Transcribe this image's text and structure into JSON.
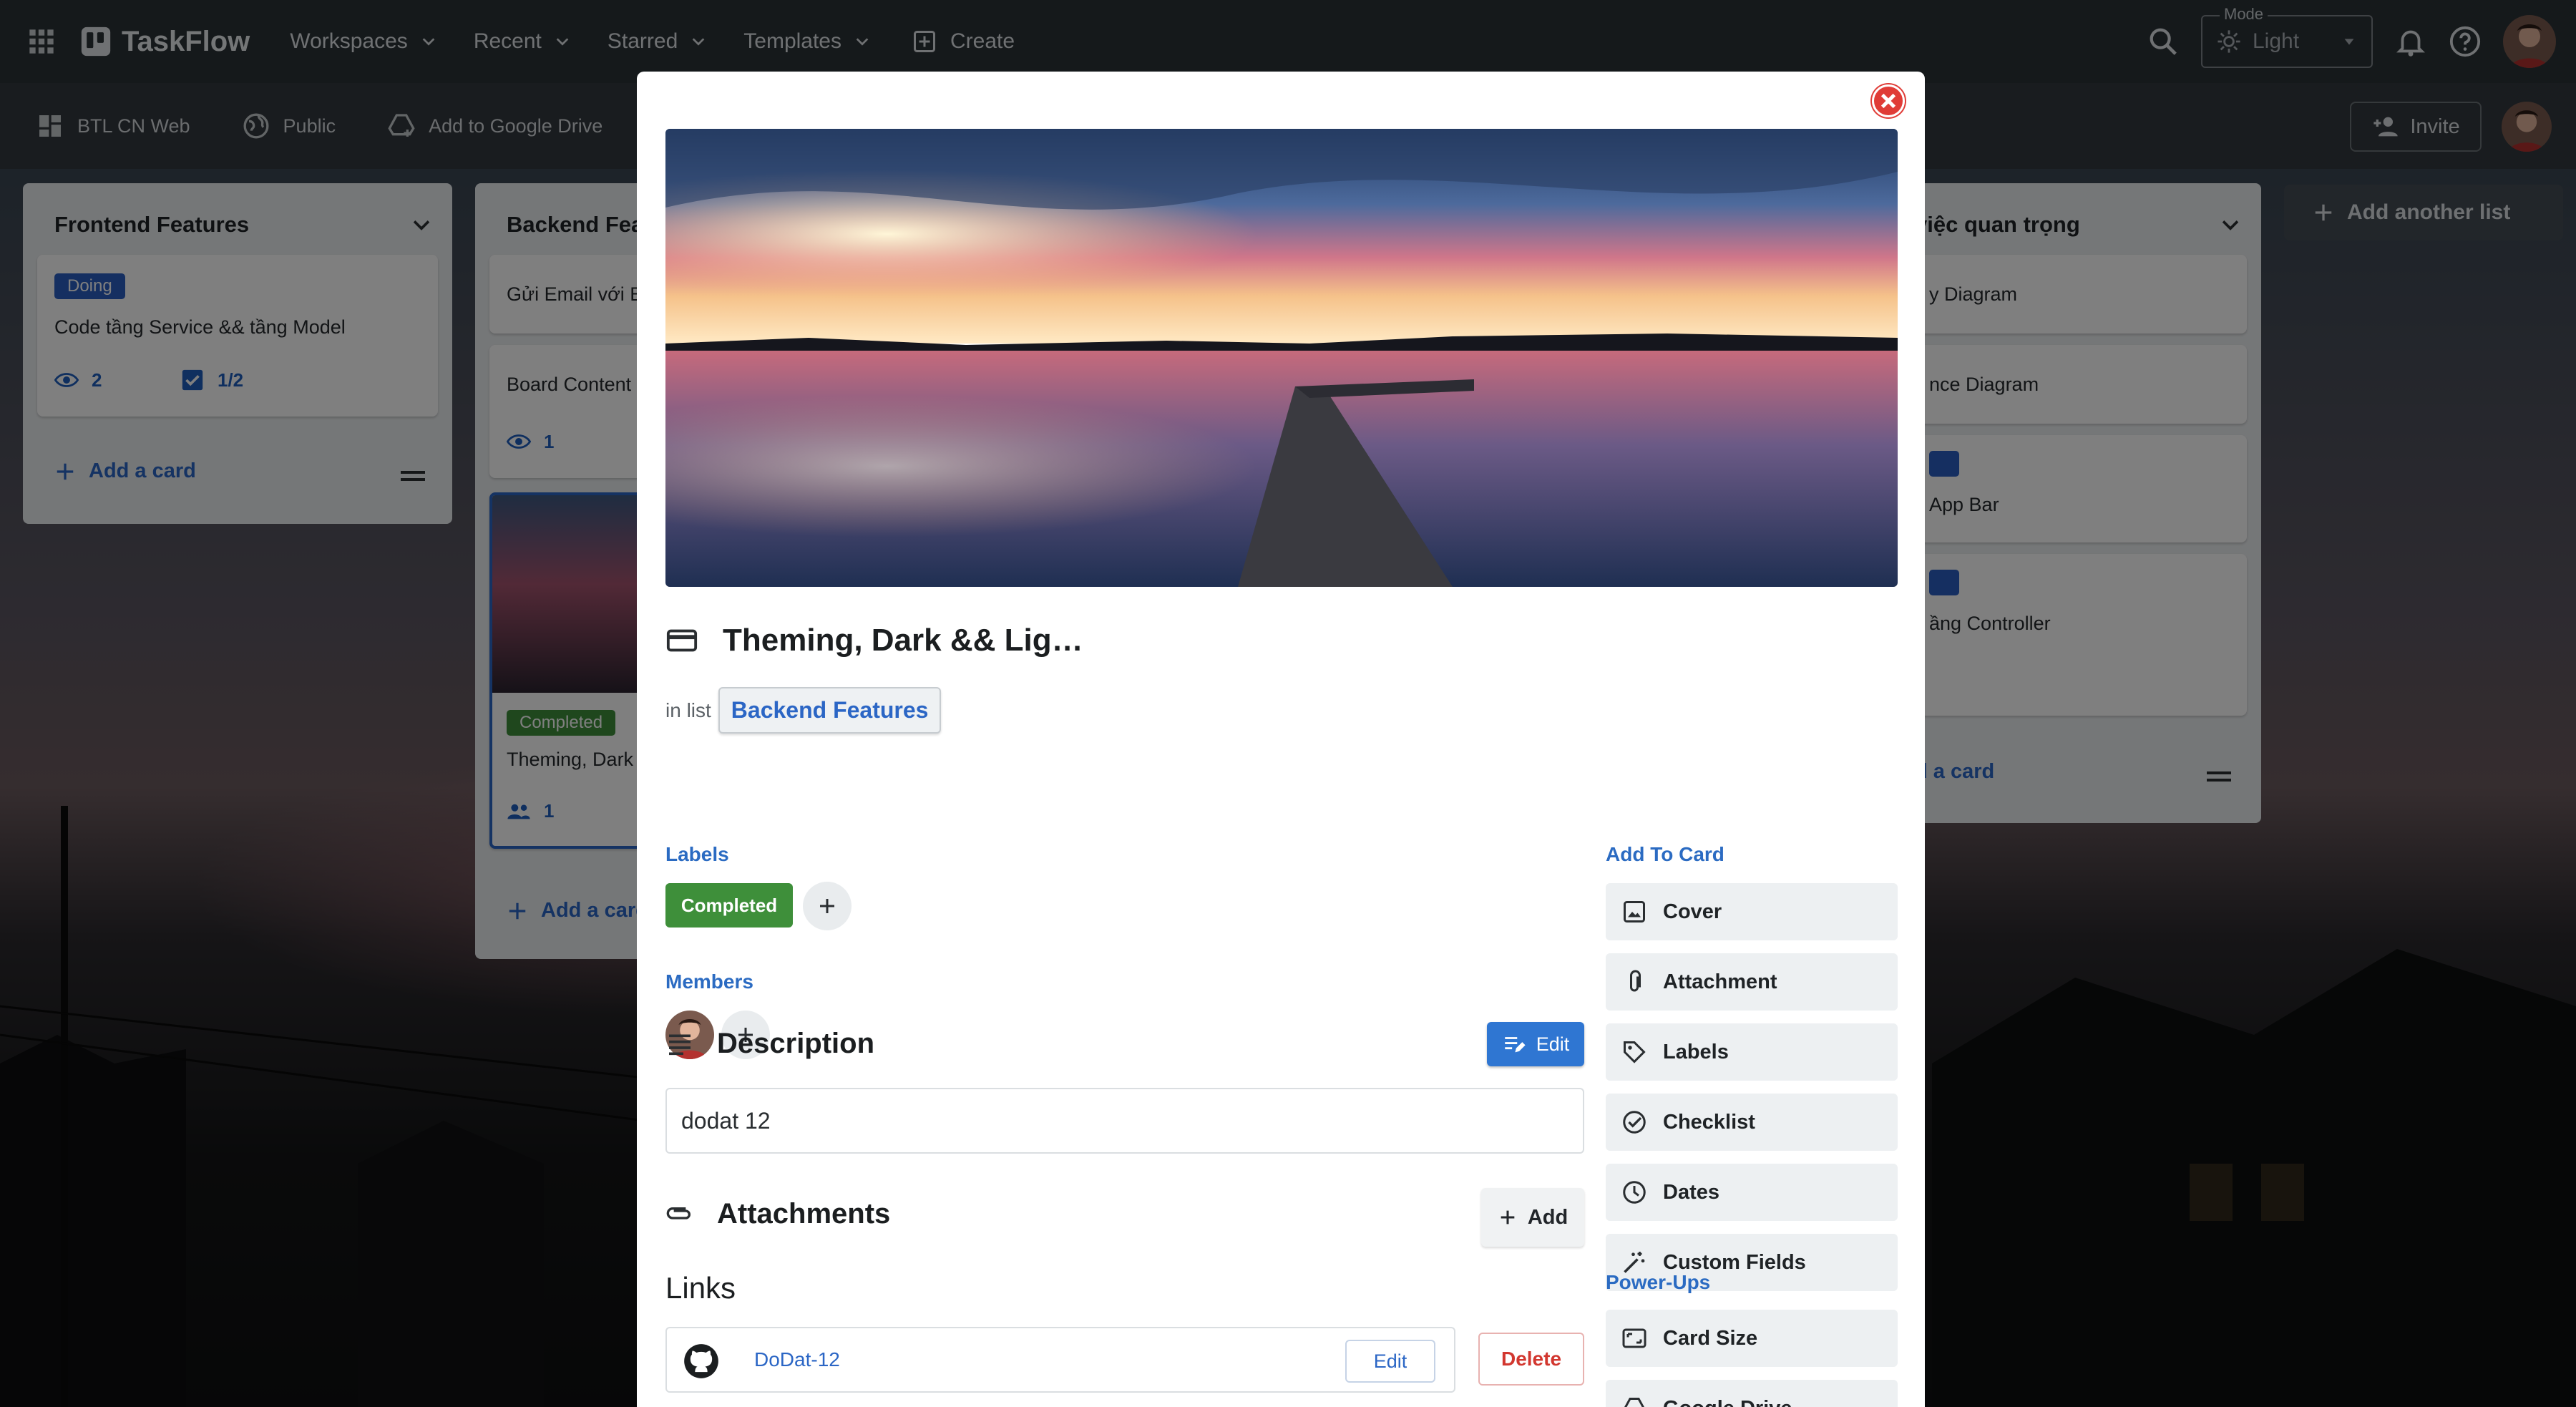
{
  "nav": {
    "brand": "TaskFlow",
    "menu": [
      {
        "label": "Workspaces"
      },
      {
        "label": "Recent"
      },
      {
        "label": "Starred"
      },
      {
        "label": "Templates"
      }
    ],
    "create_label": "Create",
    "mode_label": "Mode",
    "mode_value": "Light"
  },
  "boardbar": {
    "board_name": "BTL CN Web",
    "visibility": "Public",
    "drive": "Add to Google Drive",
    "invite": "Invite"
  },
  "columns": {
    "frontend": {
      "title": "Frontend Features",
      "card1_label": "Doing",
      "card1_title": "Code tầng Service && tầng Model",
      "card1_watch": "2",
      "card1_check": "1/2",
      "add_card": "Add a card"
    },
    "backend": {
      "title": "Backend Fea",
      "card1_title": "Gửi Email với E",
      "card2_title": "Board Content",
      "card2_watch": "1",
      "card3_label": "Completed",
      "card3_title": "Theming, Dark",
      "card3_members": "1",
      "add_card": "Add a card"
    },
    "important": {
      "title": "việc quan trọng",
      "card1_title": "y Diagram",
      "card2_title": "nce Diagram",
      "card3_title": "App Bar",
      "card4_title": "ầng Controller",
      "add_card": "d a card"
    },
    "add_list": "Add another list"
  },
  "modal": {
    "title": "Theming, Dark && Lig…",
    "in_list_prefix": "in list",
    "list_name": "Backend Features",
    "labels_heading": "Labels",
    "label_completed": "Completed",
    "members_heading": "Members",
    "description_heading": "Description",
    "edit_label": "Edit",
    "description_text": "dodat 12",
    "attachments_heading": "Attachments",
    "add_label": "Add",
    "links_heading": "Links",
    "link_text": "DoDat-12",
    "link_edit": "Edit",
    "link_delete": "Delete",
    "add_to_card_heading": "Add To Card",
    "add_to_card": {
      "cover": "Cover",
      "attachment": "Attachment",
      "labels": "Labels",
      "checklist": "Checklist",
      "dates": "Dates",
      "custom_fields": "Custom Fields"
    },
    "powerups_heading": "Power-Ups",
    "powerups": {
      "card_size": "Card Size",
      "google_drive": "Google Drive"
    }
  },
  "colors": {
    "accent": "#2b66c5",
    "label_green": "#3e8f3a",
    "label_blue": "#2b5fc2",
    "danger": "#d2372f"
  }
}
